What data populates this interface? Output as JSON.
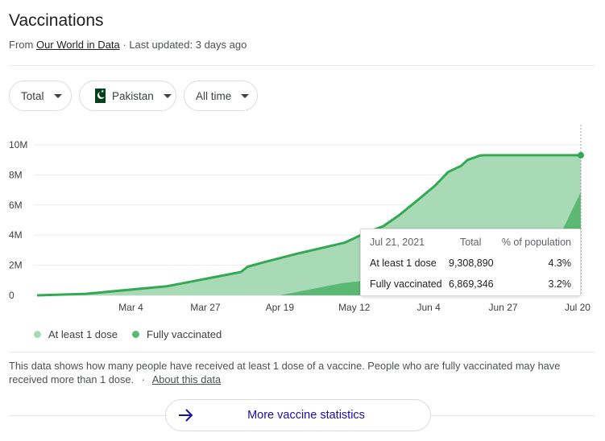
{
  "header": {
    "title": "Vaccinations",
    "source_prefix": "From",
    "source_link": "Our World in Data",
    "updated": "· Last updated: 3 days ago"
  },
  "filters": {
    "metric": "Total",
    "country": "Pakistan",
    "range": "All time"
  },
  "colors": {
    "at_least_one_fill": "#a8dab5",
    "at_least_one_line": "#34a853",
    "fully_fill": "#5bb974",
    "accent_link": "#1a0dab"
  },
  "chart_data": {
    "type": "area",
    "x_ticks": [
      "Mar 4",
      "Mar 27",
      "Apr 19",
      "May 12",
      "Jun 4",
      "Jun 27",
      "Jul 20"
    ],
    "y_ticks": [
      "0",
      "2M",
      "4M",
      "6M",
      "8M",
      "10M"
    ],
    "ylim": [
      0,
      10000000
    ],
    "xlim": [
      "2021-02-03",
      "2021-07-21"
    ],
    "grid": true,
    "legend_position": "bottom-left",
    "series": [
      {
        "name": "At least 1 dose",
        "x": [
          "2021-02-03",
          "2021-02-18",
          "2021-03-15",
          "2021-04-07",
          "2021-04-09",
          "2021-04-14",
          "2021-04-24",
          "2021-05-09",
          "2021-05-13",
          "2021-05-16",
          "2021-05-21",
          "2021-05-26",
          "2021-06-01",
          "2021-06-06",
          "2021-06-10",
          "2021-06-14",
          "2021-06-16",
          "2021-06-18",
          "2021-06-20",
          "2021-06-21",
          "2021-07-21"
        ],
        "values": [
          0,
          100000,
          600000,
          1550000,
          1900000,
          2200000,
          2750000,
          3500000,
          3900000,
          4200000,
          4600000,
          5350000,
          6400000,
          7300000,
          8200000,
          8600000,
          9000000,
          9150000,
          9300000,
          9308890,
          9308890
        ]
      },
      {
        "name": "Fully vaccinated",
        "x": [
          "2021-02-03",
          "2021-04-19",
          "2021-05-08",
          "2021-05-16",
          "2021-05-21",
          "2021-05-30",
          "2021-06-08",
          "2021-06-24",
          "2021-07-09",
          "2021-07-15",
          "2021-07-21"
        ],
        "values": [
          0,
          0,
          800000,
          1000000,
          1100000,
          1550000,
          2400000,
          3000000,
          3200000,
          4200000,
          6869346
        ]
      }
    ]
  },
  "legend": {
    "first": "At least 1 dose",
    "second": "Fully vaccinated"
  },
  "tooltip": {
    "date": "Jul 21, 2021",
    "col_total": "Total",
    "col_pct": "% of population",
    "rows": [
      {
        "label": "At least 1 dose",
        "total": "9,308,890",
        "pct": "4.3%"
      },
      {
        "label": "Fully vaccinated",
        "total": "6,869,346",
        "pct": "3.2%"
      }
    ]
  },
  "description": {
    "text": "This data shows how many people have received at least 1 dose of a vaccine. People who are fully vaccinated may have received more than 1 dose.",
    "separator": "·",
    "about_link": "About this data"
  },
  "more_button": {
    "label": "More vaccine statistics",
    "icon": "arrow-right-icon"
  }
}
